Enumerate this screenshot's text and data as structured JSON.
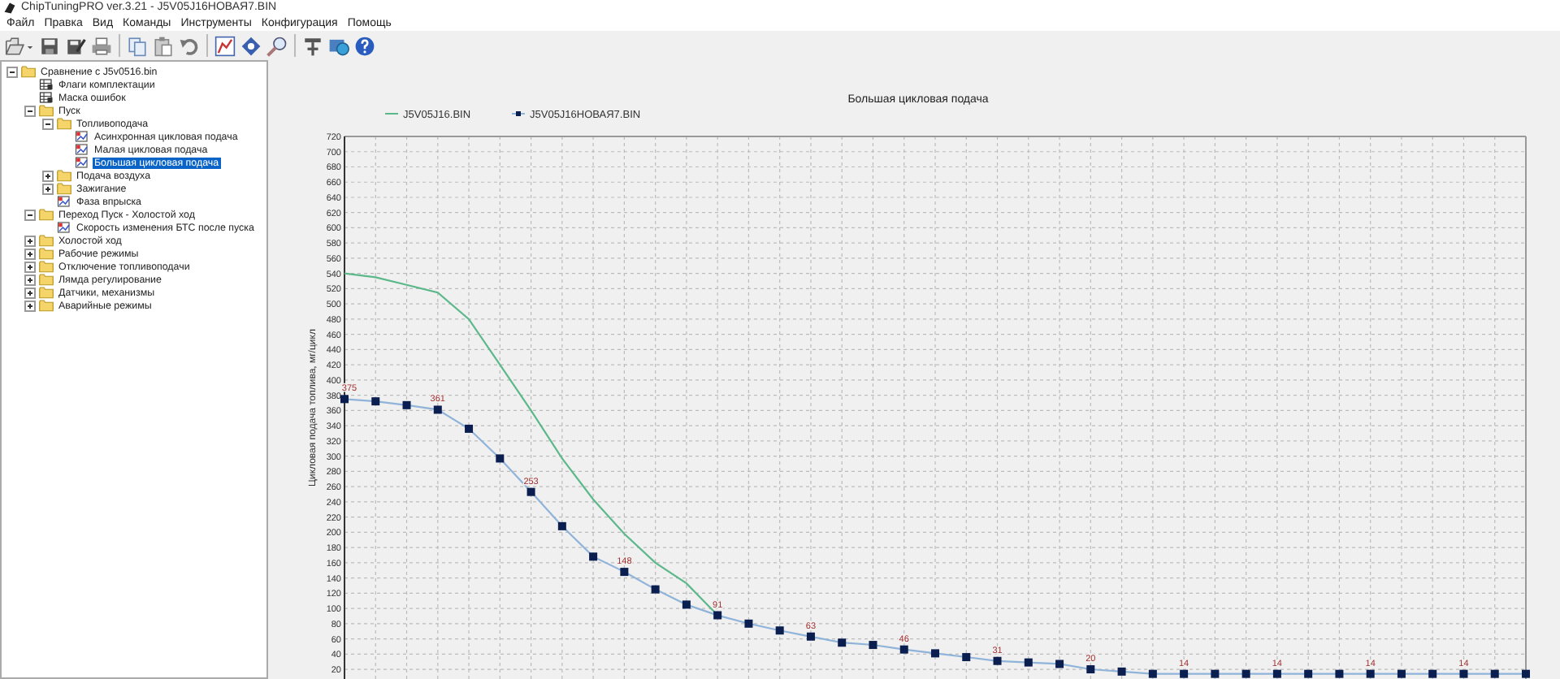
{
  "window": {
    "title": "ChipTuningPRO ver.3.21 - J5V05J16НОВАЯ7.BIN"
  },
  "menu": [
    "Файл",
    "Правка",
    "Вид",
    "Команды",
    "Инструменты",
    "Конфигурация",
    "Помощь"
  ],
  "tree": [
    {
      "label": "Сравнение с J5v0516.bin",
      "kind": "folder",
      "expanded": true,
      "selected": false,
      "children": [
        {
          "label": "Флаги комплектации",
          "kind": "flags",
          "selected": false
        },
        {
          "label": "Маска ошибок",
          "kind": "flags",
          "selected": false
        },
        {
          "label": "Пуск",
          "kind": "folder",
          "expanded": true,
          "selected": false,
          "children": [
            {
              "label": "Топливоподача",
              "kind": "folder",
              "expanded": true,
              "selected": false,
              "children": [
                {
                  "label": "Асинхронная цикловая подача",
                  "kind": "map",
                  "selected": false
                },
                {
                  "label": "Малая цикловая подача",
                  "kind": "map",
                  "selected": false
                },
                {
                  "label": "Большая цикловая подача",
                  "kind": "map",
                  "selected": true
                }
              ]
            },
            {
              "label": "Подача воздуха",
              "kind": "folder",
              "expanded": false,
              "selected": false
            },
            {
              "label": "Зажигание",
              "kind": "folder",
              "expanded": false,
              "selected": false
            },
            {
              "label": "Фаза впрыска",
              "kind": "map",
              "selected": false
            }
          ]
        },
        {
          "label": "Переход Пуск - Холостой ход",
          "kind": "folder",
          "expanded": true,
          "selected": false,
          "children": [
            {
              "label": "Скорость изменения БТС после пуска",
              "kind": "map",
              "selected": false
            }
          ]
        },
        {
          "label": "Холостой ход",
          "kind": "folder",
          "expanded": false,
          "selected": false
        },
        {
          "label": "Рабочие режимы",
          "kind": "folder",
          "expanded": false,
          "selected": false
        },
        {
          "label": "Отключение топливоподачи",
          "kind": "folder",
          "expanded": false,
          "selected": false
        },
        {
          "label": "Лямда регулирование",
          "kind": "folder",
          "expanded": false,
          "selected": false
        },
        {
          "label": "Датчики, механизмы",
          "kind": "folder",
          "expanded": false,
          "selected": false
        },
        {
          "label": "Аварийные режимы",
          "kind": "folder",
          "expanded": false,
          "selected": false
        }
      ]
    }
  ],
  "chart": {
    "chart_data": {
      "type": "line",
      "title": "Большая цикловая подача",
      "ylabel": "Цикловая подача топлива, мг/цикл",
      "ylim": [
        0,
        720
      ],
      "grid": true,
      "legend": true,
      "yticks": [
        20,
        40,
        60,
        80,
        100,
        120,
        140,
        160,
        180,
        200,
        220,
        240,
        260,
        280,
        300,
        320,
        340,
        360,
        380,
        400,
        420,
        440,
        460,
        480,
        500,
        520,
        540,
        560,
        580,
        600,
        620,
        640,
        660,
        680,
        700,
        720
      ],
      "series": [
        {
          "name": "J5V05J16.BIN",
          "color": "#5cb88a",
          "values": [
            540,
            535,
            525,
            515,
            480,
            420,
            360,
            297,
            243,
            198,
            160,
            133,
            91,
            null,
            null,
            null,
            null,
            null,
            null,
            null,
            null,
            null,
            null,
            null,
            null,
            null,
            null,
            null,
            null,
            null,
            null,
            null,
            null,
            null,
            null,
            null,
            null,
            null,
            null
          ]
        },
        {
          "name": "J5V05J16НОВАЯ7.BIN",
          "color": "#8fb3d9",
          "marker": "square",
          "values": [
            375,
            372,
            367,
            361,
            336,
            297,
            253,
            208,
            168,
            148,
            125,
            105,
            91,
            80,
            71,
            63,
            55,
            52,
            46,
            41,
            36,
            31,
            29,
            27,
            20,
            17,
            14,
            14,
            14,
            14,
            14,
            14,
            14,
            14,
            14,
            14,
            14,
            14,
            14
          ],
          "value_labels": [
            "375",
            null,
            null,
            "361",
            null,
            null,
            "253",
            null,
            null,
            "148",
            null,
            null,
            "91",
            null,
            null,
            "63",
            null,
            null,
            "46",
            null,
            null,
            "31",
            null,
            null,
            "20",
            null,
            null,
            "14",
            null,
            null,
            "14",
            null,
            null,
            "14",
            null,
            null,
            "14",
            null,
            null
          ]
        }
      ]
    }
  }
}
